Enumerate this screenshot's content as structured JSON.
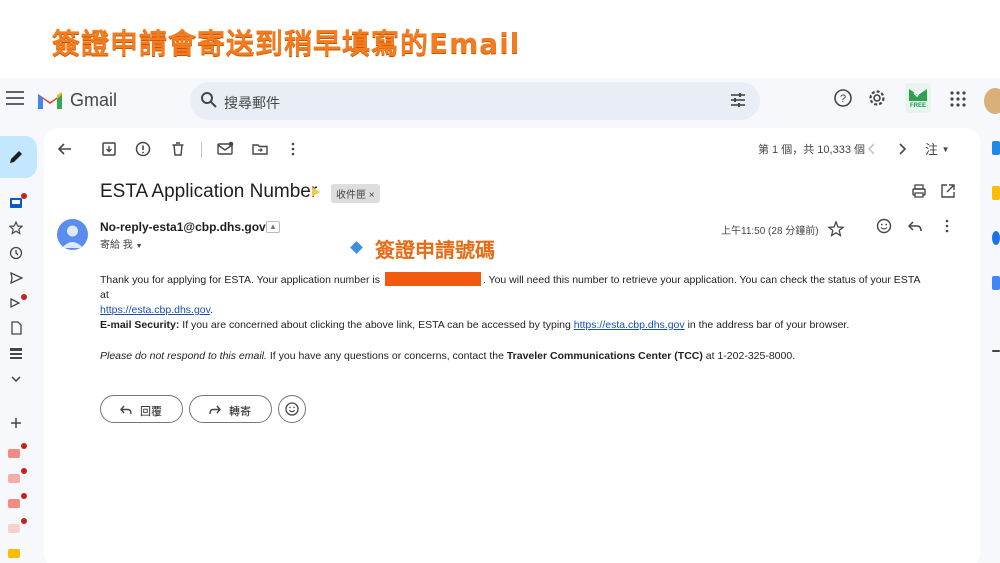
{
  "banner": {
    "title": "簽證申請會寄送到稍早填寫的Email"
  },
  "annotation": {
    "label": "簽證申請號碼"
  },
  "app": {
    "name": "Gmail"
  },
  "search": {
    "placeholder": "搜尋郵件"
  },
  "badge": {
    "free": "FREE"
  },
  "toolbar": {
    "pager": "第 1 個，共 10,333 個",
    "lang": "注"
  },
  "email": {
    "subject": "ESTA Application Number",
    "label_chip": "收件匣",
    "label_chip_close": "×",
    "sender": "No-reply-esta1@cbp.dhs.gov",
    "to": "寄給 我",
    "time": "上午11:50 (28 分鐘前)",
    "para1_a": "Thank you for applying for ESTA. Your application number is ",
    "para1_b": ". You will need this number to retrieve your application. You can check the status of your ESTA at",
    "para1_link": "https://esta.cbp.dhs.gov",
    "para1_end": ".",
    "para2_bold": "E-mail Security:",
    "para2_a": " If you are concerned about clicking the above link, ESTA can be accessed by typing ",
    "para2_link": "https://esta.cbp.dhs.gov",
    "para2_b": " in the address bar of your browser.",
    "para3_italic": "Please do not respond to this email.",
    "para3_a": " If you have any questions or concerns, contact the ",
    "para3_bold": "Traveler Communications Center (TCC)",
    "para3_b": " at 1-202-325-8000."
  },
  "actions": {
    "reply": "回覆",
    "forward": "轉寄"
  },
  "colors": {
    "accent": "#f47c20",
    "redaction": "#f25a0f",
    "link": "#1a4fb0",
    "compose": "#c2e7ff"
  }
}
